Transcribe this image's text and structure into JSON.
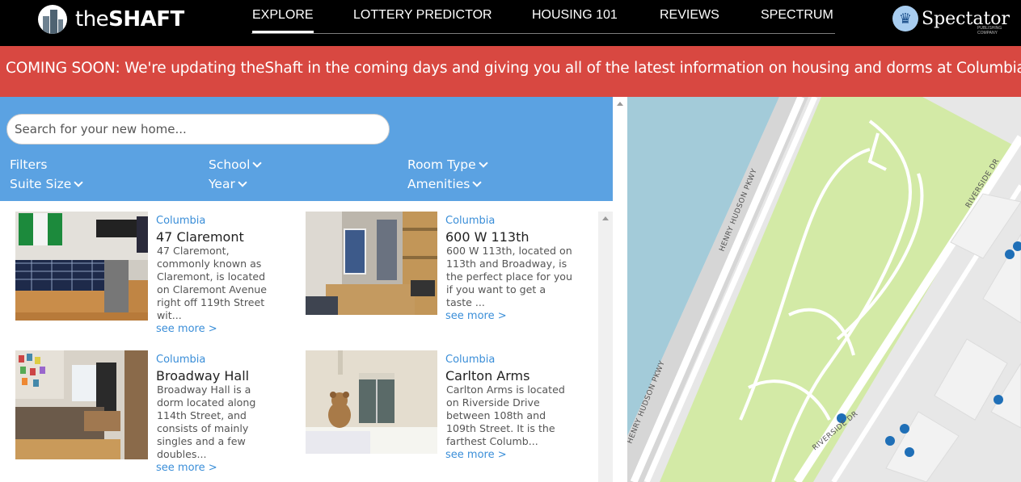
{
  "nav": {
    "logo_prefix": "the",
    "logo_bold": "SHAFT",
    "links": [
      "EXPLORE",
      "LOTTERY PREDICTOR",
      "HOUSING 101",
      "REVIEWS",
      "SPECTRUM"
    ],
    "active": "EXPLORE",
    "spectator_name": "Spectator",
    "spectator_sub": "PUBLISHING COMPANY"
  },
  "banner": {
    "text": "COMING SOON: We're updating theShaft in the coming days and giving you all of the latest information on housing and dorms at Columbia. Stay tuned!"
  },
  "search": {
    "placeholder": "Search for your new home..."
  },
  "filters": {
    "label": "Filters",
    "items": [
      "School",
      "Room Type",
      "Suite Size",
      "Year",
      "Amenities"
    ]
  },
  "listings": [
    {
      "school": "Columbia",
      "title": "47 Claremont",
      "desc": "47 Claremont, commonly known as Claremont, is located on Claremont Avenue right off 119th Street wit...",
      "more": "see more >"
    },
    {
      "school": "Columbia",
      "title": "600 W 113th",
      "desc": "600 W 113th, located on 113th and Broadway, is the perfect place for you if you want to get a taste ...",
      "more": "see more >"
    },
    {
      "school": "Columbia",
      "title": "Broadway Hall",
      "desc": "Broadway Hall is a dorm located along 114th Street, and consists of mainly singles and a few doubles...",
      "more": "see more >"
    },
    {
      "school": "Columbia",
      "title": "Carlton Arms",
      "desc": "Carlton Arms is located on Riverside Drive between 108th and 109th Street. It is the farthest Columb...",
      "more": "see more >"
    }
  ],
  "map": {
    "labels": [
      "HENRY HUDSON PKWY",
      "HENRY HUDSON PKWY",
      "RIVERSIDE DR",
      "RIVERSIDE DR"
    ],
    "colors": {
      "water": "#a3cbd9",
      "park": "#d3eaa6",
      "road": "#ffffff",
      "land": "#e7e7e7",
      "marker": "#1f6fb7"
    }
  },
  "colors": {
    "nav_bg": "#000000",
    "banner_bg": "#d84841",
    "filter_bg": "#5ba2e2",
    "link": "#3a8ed8"
  }
}
